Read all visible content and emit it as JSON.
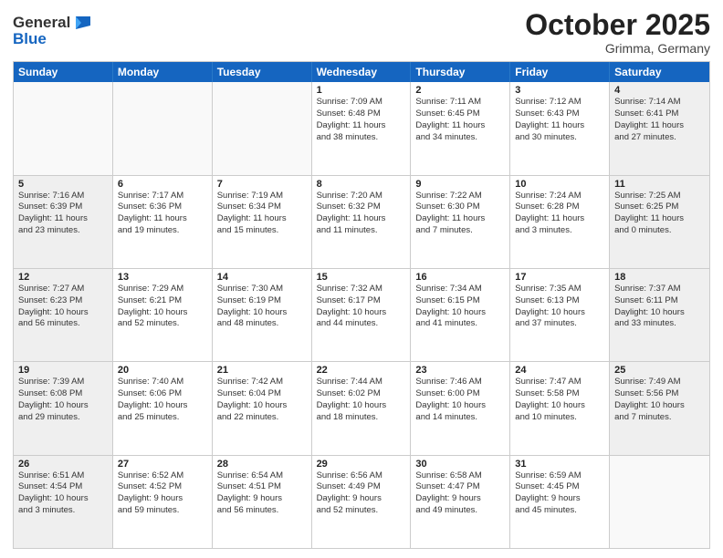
{
  "header": {
    "logo_line1": "General",
    "logo_line2": "Blue",
    "month": "October 2025",
    "location": "Grimma, Germany"
  },
  "days_of_week": [
    "Sunday",
    "Monday",
    "Tuesday",
    "Wednesday",
    "Thursday",
    "Friday",
    "Saturday"
  ],
  "weeks": [
    [
      {
        "day": "",
        "info": ""
      },
      {
        "day": "",
        "info": ""
      },
      {
        "day": "",
        "info": ""
      },
      {
        "day": "1",
        "info": "Sunrise: 7:09 AM\nSunset: 6:48 PM\nDaylight: 11 hours\nand 38 minutes."
      },
      {
        "day": "2",
        "info": "Sunrise: 7:11 AM\nSunset: 6:45 PM\nDaylight: 11 hours\nand 34 minutes."
      },
      {
        "day": "3",
        "info": "Sunrise: 7:12 AM\nSunset: 6:43 PM\nDaylight: 11 hours\nand 30 minutes."
      },
      {
        "day": "4",
        "info": "Sunrise: 7:14 AM\nSunset: 6:41 PM\nDaylight: 11 hours\nand 27 minutes."
      }
    ],
    [
      {
        "day": "5",
        "info": "Sunrise: 7:16 AM\nSunset: 6:39 PM\nDaylight: 11 hours\nand 23 minutes."
      },
      {
        "day": "6",
        "info": "Sunrise: 7:17 AM\nSunset: 6:36 PM\nDaylight: 11 hours\nand 19 minutes."
      },
      {
        "day": "7",
        "info": "Sunrise: 7:19 AM\nSunset: 6:34 PM\nDaylight: 11 hours\nand 15 minutes."
      },
      {
        "day": "8",
        "info": "Sunrise: 7:20 AM\nSunset: 6:32 PM\nDaylight: 11 hours\nand 11 minutes."
      },
      {
        "day": "9",
        "info": "Sunrise: 7:22 AM\nSunset: 6:30 PM\nDaylight: 11 hours\nand 7 minutes."
      },
      {
        "day": "10",
        "info": "Sunrise: 7:24 AM\nSunset: 6:28 PM\nDaylight: 11 hours\nand 3 minutes."
      },
      {
        "day": "11",
        "info": "Sunrise: 7:25 AM\nSunset: 6:25 PM\nDaylight: 11 hours\nand 0 minutes."
      }
    ],
    [
      {
        "day": "12",
        "info": "Sunrise: 7:27 AM\nSunset: 6:23 PM\nDaylight: 10 hours\nand 56 minutes."
      },
      {
        "day": "13",
        "info": "Sunrise: 7:29 AM\nSunset: 6:21 PM\nDaylight: 10 hours\nand 52 minutes."
      },
      {
        "day": "14",
        "info": "Sunrise: 7:30 AM\nSunset: 6:19 PM\nDaylight: 10 hours\nand 48 minutes."
      },
      {
        "day": "15",
        "info": "Sunrise: 7:32 AM\nSunset: 6:17 PM\nDaylight: 10 hours\nand 44 minutes."
      },
      {
        "day": "16",
        "info": "Sunrise: 7:34 AM\nSunset: 6:15 PM\nDaylight: 10 hours\nand 41 minutes."
      },
      {
        "day": "17",
        "info": "Sunrise: 7:35 AM\nSunset: 6:13 PM\nDaylight: 10 hours\nand 37 minutes."
      },
      {
        "day": "18",
        "info": "Sunrise: 7:37 AM\nSunset: 6:11 PM\nDaylight: 10 hours\nand 33 minutes."
      }
    ],
    [
      {
        "day": "19",
        "info": "Sunrise: 7:39 AM\nSunset: 6:08 PM\nDaylight: 10 hours\nand 29 minutes."
      },
      {
        "day": "20",
        "info": "Sunrise: 7:40 AM\nSunset: 6:06 PM\nDaylight: 10 hours\nand 25 minutes."
      },
      {
        "day": "21",
        "info": "Sunrise: 7:42 AM\nSunset: 6:04 PM\nDaylight: 10 hours\nand 22 minutes."
      },
      {
        "day": "22",
        "info": "Sunrise: 7:44 AM\nSunset: 6:02 PM\nDaylight: 10 hours\nand 18 minutes."
      },
      {
        "day": "23",
        "info": "Sunrise: 7:46 AM\nSunset: 6:00 PM\nDaylight: 10 hours\nand 14 minutes."
      },
      {
        "day": "24",
        "info": "Sunrise: 7:47 AM\nSunset: 5:58 PM\nDaylight: 10 hours\nand 10 minutes."
      },
      {
        "day": "25",
        "info": "Sunrise: 7:49 AM\nSunset: 5:56 PM\nDaylight: 10 hours\nand 7 minutes."
      }
    ],
    [
      {
        "day": "26",
        "info": "Sunrise: 6:51 AM\nSunset: 4:54 PM\nDaylight: 10 hours\nand 3 minutes."
      },
      {
        "day": "27",
        "info": "Sunrise: 6:52 AM\nSunset: 4:52 PM\nDaylight: 9 hours\nand 59 minutes."
      },
      {
        "day": "28",
        "info": "Sunrise: 6:54 AM\nSunset: 4:51 PM\nDaylight: 9 hours\nand 56 minutes."
      },
      {
        "day": "29",
        "info": "Sunrise: 6:56 AM\nSunset: 4:49 PM\nDaylight: 9 hours\nand 52 minutes."
      },
      {
        "day": "30",
        "info": "Sunrise: 6:58 AM\nSunset: 4:47 PM\nDaylight: 9 hours\nand 49 minutes."
      },
      {
        "day": "31",
        "info": "Sunrise: 6:59 AM\nSunset: 4:45 PM\nDaylight: 9 hours\nand 45 minutes."
      },
      {
        "day": "",
        "info": ""
      }
    ]
  ]
}
